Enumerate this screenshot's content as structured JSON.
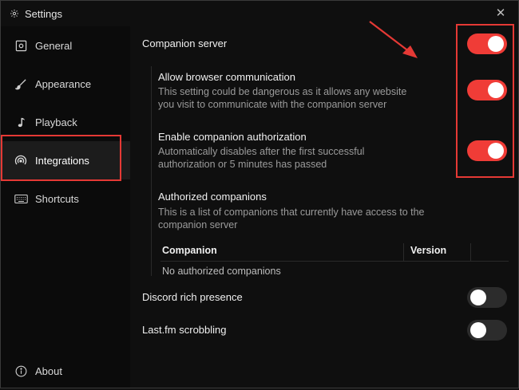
{
  "window": {
    "title": "Settings",
    "close_glyph": "✕"
  },
  "sidebar": {
    "items": [
      {
        "label": "General",
        "icon": "general-icon"
      },
      {
        "label": "Appearance",
        "icon": "brush-icon"
      },
      {
        "label": "Playback",
        "icon": "music-note-icon"
      },
      {
        "label": "Integrations",
        "icon": "integrations-icon",
        "active": true
      },
      {
        "label": "Shortcuts",
        "icon": "keyboard-icon"
      }
    ],
    "about_label": "About"
  },
  "settings": {
    "companion_server": {
      "title": "Companion server",
      "enabled": true
    },
    "allow_browser": {
      "title": "Allow browser communication",
      "desc_line1": "This setting could be dangerous as it allows any website",
      "desc_line2": "you visit to communicate with the companion server",
      "enabled": true
    },
    "companion_auth": {
      "title": "Enable companion authorization",
      "desc_line1": "Automatically disables after the first successful",
      "desc_line2": "authorization or 5 minutes has passed",
      "enabled": true
    },
    "authorized": {
      "title": "Authorized companions",
      "desc_line1": "This is a list of companions that currently have access to the",
      "desc_line2": "companion server",
      "columns": [
        "Companion",
        "Version"
      ],
      "empty_text": "No authorized companions"
    },
    "discord": {
      "title": "Discord rich presence",
      "enabled": false
    },
    "lastfm": {
      "title": "Last.fm scrobbling",
      "enabled": false
    }
  },
  "colors": {
    "accent": "#f03c37",
    "annotation": "#e53935",
    "background": "#0f0f0f"
  }
}
